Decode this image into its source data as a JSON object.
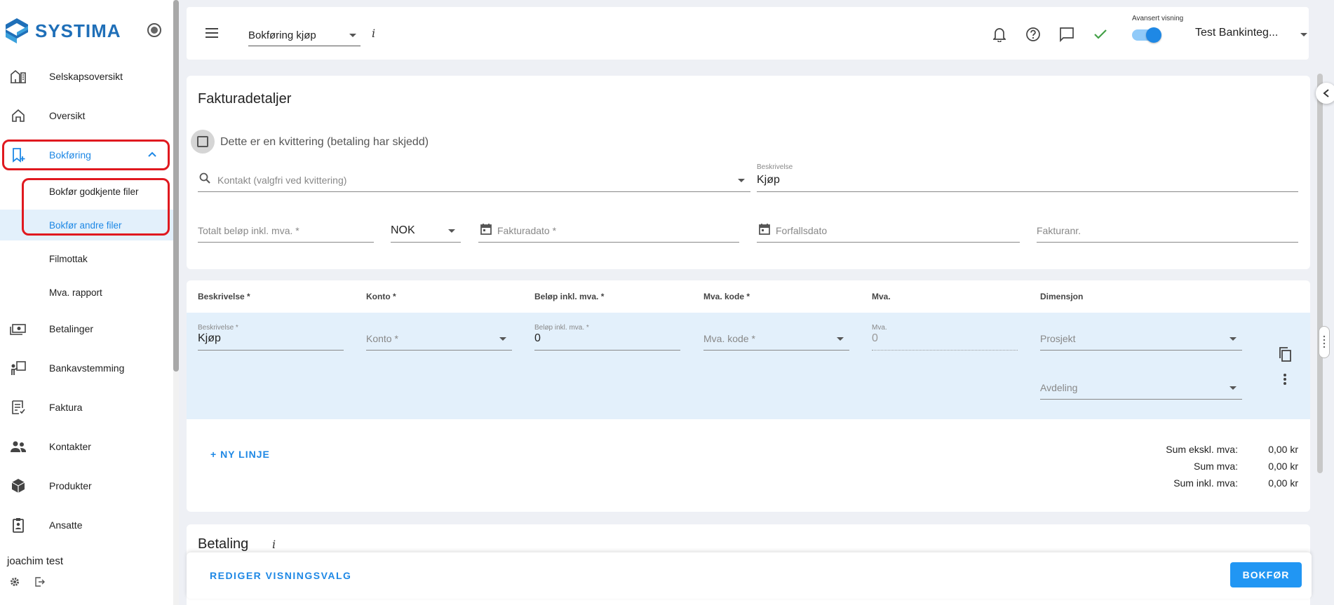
{
  "sidebar": {
    "logo_text": "SYSTIMA",
    "items": [
      {
        "label": "Selskapsoversikt",
        "icon": "buildings-icon"
      },
      {
        "label": "Oversikt",
        "icon": "home-icon"
      },
      {
        "label": "Bokføring",
        "icon": "bookmark-add-icon"
      },
      {
        "label": "Betalinger",
        "icon": "cash-icon"
      },
      {
        "label": "Bankavstemming",
        "icon": "reconcile-icon"
      },
      {
        "label": "Faktura",
        "icon": "invoice-icon"
      },
      {
        "label": "Kontakter",
        "icon": "people-icon"
      },
      {
        "label": "Produkter",
        "icon": "box-icon"
      },
      {
        "label": "Ansatte",
        "icon": "badge-icon"
      }
    ],
    "subitems": [
      {
        "label": "Bokfør godkjente filer"
      },
      {
        "label": "Bokfør andre filer"
      },
      {
        "label": "Filmottak"
      },
      {
        "label": "Mva. rapport"
      }
    ],
    "user": "joachim test"
  },
  "topbar": {
    "page_select": "Bokføring kjøp",
    "info": "i",
    "advanced_label": "Avansert visning",
    "company": "Test Bankinteg..."
  },
  "invoice": {
    "title": "Fakturadetaljer",
    "receipt_checkbox": "Dette er en kvittering (betaling har skjedd)",
    "contact_placeholder": "Kontakt (valgfri ved kvittering)",
    "description_label": "Beskrivelse",
    "description_value": "Kjøp",
    "total_placeholder": "Totalt beløp inkl. mva. *",
    "currency": "NOK",
    "invoice_date_placeholder": "Fakturadato *",
    "due_date_placeholder": "Forfallsdato",
    "invoice_no_placeholder": "Fakturanr."
  },
  "lines": {
    "headers": [
      "Beskrivelse *",
      "Konto *",
      "Beløp inkl. mva. *",
      "Mva. kode *",
      "Mva.",
      "Dimensjon"
    ],
    "row": {
      "desc_label": "Beskrivelse *",
      "desc_value": "Kjøp",
      "konto_placeholder": "Konto *",
      "amount_label": "Beløp inkl. mva. *",
      "amount_value": "0",
      "vatcode_placeholder": "Mva. kode *",
      "vat_label": "Mva.",
      "vat_value": "0",
      "project_placeholder": "Prosjekt",
      "department_placeholder": "Avdeling"
    },
    "new_line": "+ NY LINJE",
    "sums": [
      {
        "label": "Sum ekskl. mva:",
        "value": "0,00 kr"
      },
      {
        "label": "Sum mva:",
        "value": "0,00 kr"
      },
      {
        "label": "Sum inkl. mva:",
        "value": "0,00 kr"
      }
    ]
  },
  "payment": {
    "title": "Betaling",
    "info": "i"
  },
  "footer": {
    "edit_view": "REDIGER VISNINGSVALG",
    "submit": "BOKFØR"
  },
  "colors": {
    "accent": "#1e88e5",
    "highlight": "#e0191f",
    "row_bg": "#e3f0fb"
  }
}
